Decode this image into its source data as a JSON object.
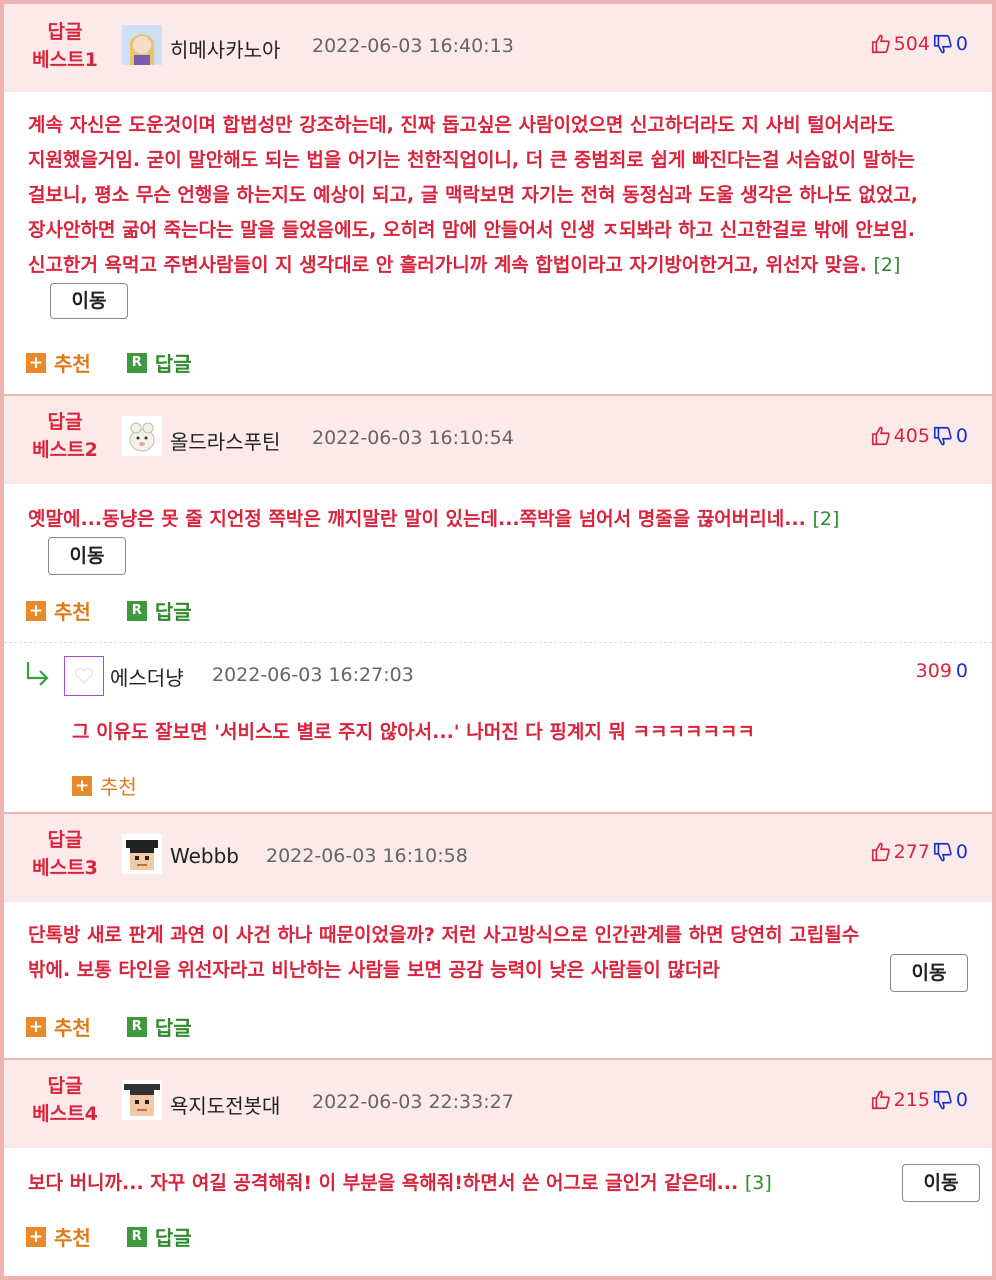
{
  "comments": [
    {
      "best": [
        "답글",
        "베스트1"
      ],
      "nick": "히메사카노아",
      "date": "2022-06-03 16:40:13",
      "up": "504",
      "down": "0",
      "text": "계속 자신은 도운것이며 합법성만 강조하는데, 진짜 돕고싶은 사람이었으면 신고하더라도 지 사비 털어서라도 지원했을거임. 굳이 말안해도 되는 법을 어기는 천한직업이니, 더 큰 중범죄로 쉽게 빠진다는걸 서슴없이 말하는 걸보니, 평소 무슨 언행을 하는지도 예상이 되고, 글 맥락보면 자기는 전혀 동정심과 도울 생각은 하나도 없었고, 장사안하면 굶어 죽는다는 말을 들었음에도, 오히려 맘에 안들어서 인생 ㅈ되봐라 하고 신고한걸로 밖에 안보임. 신고한거 욕먹고 주변사람들이 지 생각대로 안 흘러가니까 계속 합법이라고 자기방어한거고, 위선자 맞음.",
      "count": "[2]"
    },
    {
      "best": [
        "답글",
        "베스트2"
      ],
      "nick": "올드라스푸틴",
      "date": "2022-06-03 16:10:54",
      "up": "405",
      "down": "0",
      "text": "옛말에...동냥은 못 줄 지언정 쪽박은 깨지말란 말이 있는데...쪽박을 넘어서 명줄을 끊어버리네...",
      "count": "[2]"
    },
    {
      "best": [
        "답글",
        "베스트3"
      ],
      "nick": "Webbb",
      "date": "2022-06-03 16:10:58",
      "up": "277",
      "down": "0",
      "text": "단톡방 새로 판게 과연 이 사건 하나 때문이었을까? 저런 사고방식으로 인간관계를 하면 당연히 고립될수 밖에. 보통 타인을 위선자라고 비난하는 사람들 보면 공감 능력이 낮은 사람들이 많더라",
      "count": ""
    },
    {
      "best": [
        "답글",
        "베스트4"
      ],
      "nick": "욕지도전봇대",
      "date": "2022-06-03 22:33:27",
      "up": "215",
      "down": "0",
      "text": "보다 버니까... 자꾸 여길 공격해줘! 이 부분을 욕해줘!하면서 쓴 어그로 글인거 같은데...",
      "count": "[3]"
    }
  ],
  "reply": {
    "nick": "에스더냥",
    "date": "2022-06-03 16:27:03",
    "up": "309",
    "down": "0",
    "text": "그 이유도 잘보면 '서비스도 별로 주지 않아서...' 나머진 다 핑계지 뭐 ㅋㅋㅋㅋㅋㅋㅋ"
  },
  "labels": {
    "move": "이동",
    "recommend": "추천",
    "reply": "답글",
    "plus": "+",
    "r": "R"
  },
  "icons": {
    "thumb_up": "thumb-up-icon",
    "thumb_down": "thumb-down-icon",
    "reply_arrow": "reply-arrow-icon"
  },
  "colors": {
    "accent": "#d8243c",
    "header_bg": "#fceaea",
    "border": "#f0b3b3",
    "down": "#1a31c8",
    "count": "#2d8c2d",
    "recommend": "#e07a18",
    "reply": "#2f8a2f"
  }
}
